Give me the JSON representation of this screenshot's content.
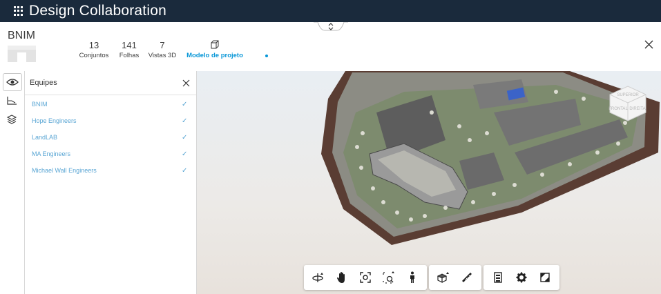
{
  "app": {
    "title": "Design Collaboration"
  },
  "project": {
    "name": "BNIM",
    "stats": [
      {
        "value": "13",
        "label": "Conjuntos"
      },
      {
        "value": "141",
        "label": "Folhas"
      },
      {
        "value": "7",
        "label": "Vistas 3D"
      }
    ],
    "model_label": "Modelo de projeto"
  },
  "panel": {
    "title": "Equipes",
    "teams": [
      {
        "name": "BNIM",
        "selected": true
      },
      {
        "name": "Hope Engineers",
        "selected": true
      },
      {
        "name": "LandLAB",
        "selected": true
      },
      {
        "name": "MA Engineers",
        "selected": true
      },
      {
        "name": "Michael Wall Engineers",
        "selected": true
      }
    ]
  },
  "viewer": {
    "navcube_faces": [
      "SUPERIOR",
      "FRONTAL",
      "DIREITA"
    ]
  },
  "toolbar": {
    "groups": [
      [
        "orbit-icon",
        "pan-icon",
        "fit-view-icon",
        "zoom-window-icon",
        "walk-icon"
      ],
      [
        "section-box-icon",
        "measure-icon"
      ],
      [
        "model-browser-icon",
        "settings-icon",
        "fullscreen-icon"
      ]
    ]
  },
  "colors": {
    "topbar": "#1a2a3c",
    "accent": "#0696d7",
    "team_text": "#5aa6d4"
  }
}
